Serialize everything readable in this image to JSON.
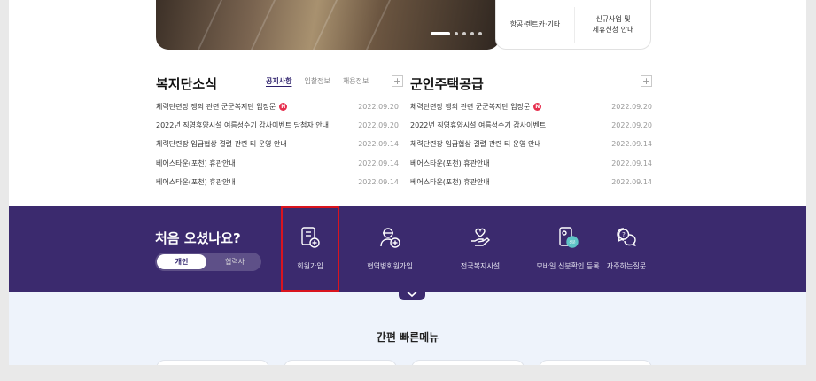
{
  "banner": {
    "quick_links": [
      {
        "label": "항공·렌트카·기타"
      },
      {
        "label": "신규사업 및\n제휴신청 안내"
      }
    ]
  },
  "welfare_news": {
    "title": "복지단소식",
    "tabs": [
      "공지사항",
      "입찰정보",
      "채용정보"
    ],
    "plus": "+",
    "items": [
      {
        "text": "체력단련장 쟁의 관련 군군복지단 입장문",
        "badge": "N",
        "date": "2022.09.20"
      },
      {
        "text": "2022년 직영휴양시설 여름성수기 감사이벤트 당첨자 안내",
        "date": "2022.09.20"
      },
      {
        "text": "체력단련장 임금협상 결렬 관련 티 운영 안내",
        "date": "2022.09.14"
      },
      {
        "text": "베어스타운(포천) 휴관안내",
        "date": "2022.09.14"
      },
      {
        "text": "베어스타운(포천) 휴관안내",
        "date": "2022.09.14"
      }
    ]
  },
  "housing": {
    "title": "군인주택공급",
    "plus": "+",
    "items": [
      {
        "text": "체력단련장 쟁의 관련 군군복지단 입장문",
        "badge": "N",
        "date": "2022.09.20"
      },
      {
        "text": "2022년 직영휴양시설 여름성수기 감사이벤트",
        "date": "2022.09.20"
      },
      {
        "text": "체력단련장 임금협상 결렬 관련 티 운영 안내",
        "date": "2022.09.14"
      },
      {
        "text": "베어스타운(포천) 휴관안내",
        "date": "2022.09.14"
      },
      {
        "text": "베어스타운(포천) 휴관안내",
        "date": "2022.09.14"
      }
    ]
  },
  "first_visit": {
    "title": "처음 오셨나요?",
    "toggle": {
      "on": "개인",
      "off": "협력사"
    },
    "services": [
      {
        "label": "회원가입",
        "icon": "member-join-icon"
      },
      {
        "label": "현역병회원가입",
        "icon": "soldier-join-icon"
      },
      {
        "label": "전국복지시설",
        "icon": "welfare-facility-icon"
      },
      {
        "label": "모바일 신분확인 등록",
        "icon": "mobile-id-icon"
      },
      {
        "label": "자주하는질문",
        "icon": "faq-icon"
      }
    ],
    "highlight_color": "#d9141e"
  },
  "quick_menu": {
    "title": "간편 빠른메뉴"
  },
  "colors": {
    "brand_purple": "#3b2a6e",
    "badge_red": "#e62e4d",
    "light_bg": "#eef3fb"
  }
}
